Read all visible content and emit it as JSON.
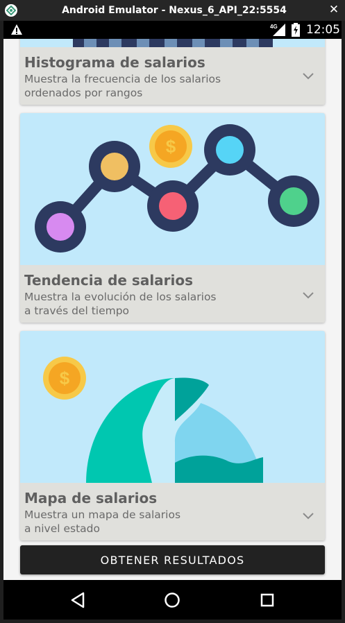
{
  "window": {
    "title": "Android Emulator - Nexus_6_API_22:5554"
  },
  "status_bar": {
    "time": "12:05",
    "network": "4G"
  },
  "cards": [
    {
      "title": "Histograma de salarios",
      "desc_line1": "Muestra la frecuencia de los salarios",
      "desc_line2": "ordenados por rangos"
    },
    {
      "title": "Tendencia de salarios",
      "desc_line1": "Muestra la evolución de los salarios",
      "desc_line2": "a través del tiempo"
    },
    {
      "title": "Mapa de salarios",
      "desc_line1": "Muestra un mapa de salarios",
      "desc_line2": "a nivel estado"
    }
  ],
  "action_button": {
    "label": "OBTENER RESULTADOS"
  },
  "icons": {
    "back": "back-triangle-icon",
    "home": "home-circle-icon",
    "recents": "recents-square-icon",
    "expand": "chevron-down-icon"
  },
  "colors": {
    "card_image_bg": "#c1e9fb",
    "card_info_bg": "#e0e0dc",
    "button_bg": "#222222",
    "chart_node_ring": "#2d3a60",
    "coin": "#f5b731"
  }
}
